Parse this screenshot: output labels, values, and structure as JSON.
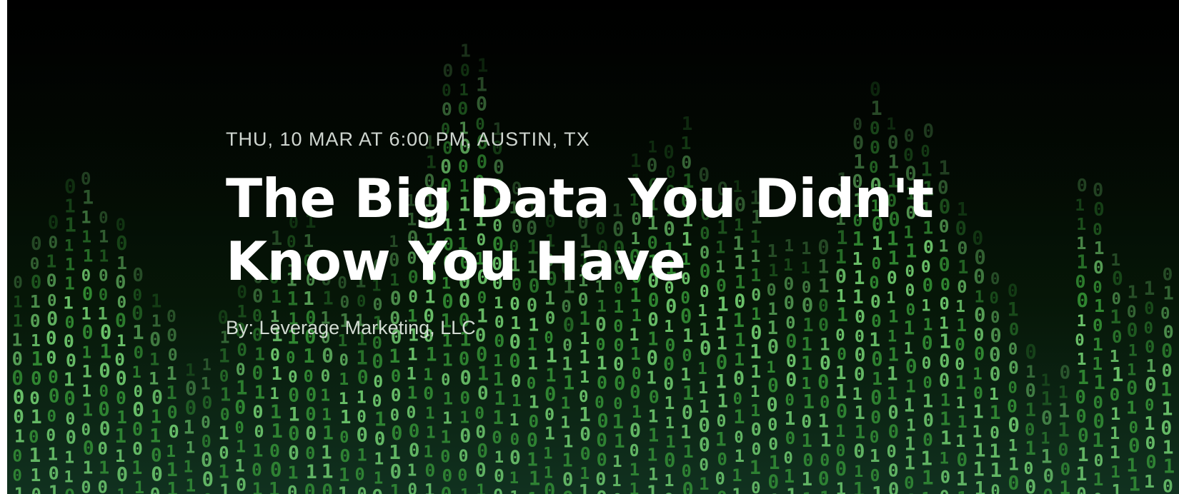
{
  "event": {
    "meta": "THU, 10 MAR AT 6:00 PM, AUSTIN, TX",
    "title": "The Big Data You Didn't Know You Have",
    "author": "By: Leverage Marketing, LLC"
  },
  "colors": {
    "background": "#000000",
    "digit_bright": "#8dfc8a",
    "digit_mid": "#3fae3f",
    "digit_dark": "#0f3d12",
    "text_primary": "#ffffff",
    "text_secondary": "#cfd6d0"
  }
}
